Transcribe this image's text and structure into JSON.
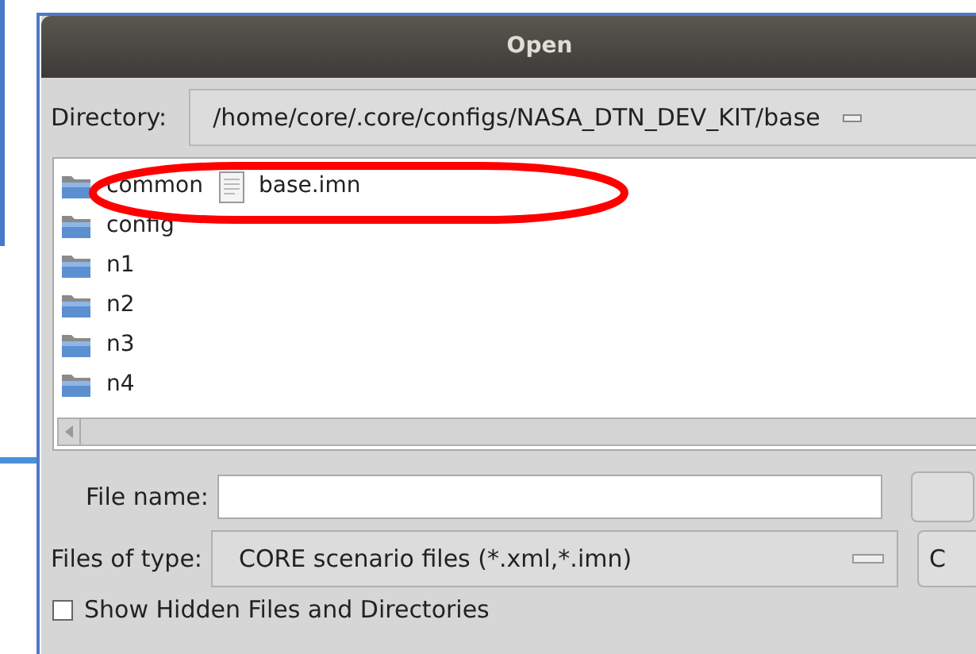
{
  "window": {
    "title": "Open"
  },
  "directory": {
    "label": "Directory:",
    "value": "/home/core/.core/configs/NASA_DTN_DEV_KIT/base"
  },
  "files": [
    [
      {
        "kind": "folder",
        "name": "common"
      },
      {
        "kind": "folder",
        "name": "config"
      },
      {
        "kind": "folder",
        "name": "n1"
      },
      {
        "kind": "folder",
        "name": "n2"
      },
      {
        "kind": "folder",
        "name": "n3"
      },
      {
        "kind": "folder",
        "name": "n4"
      }
    ],
    [
      {
        "kind": "file",
        "name": "base.imn"
      }
    ]
  ],
  "file_name": {
    "label": "File name:"
  },
  "file_type": {
    "label": "Files of type:",
    "value": "CORE scenario files (*.xml,*.imn)"
  },
  "show_hidden": {
    "label": "Show Hidden Files and Directories",
    "checked": false
  },
  "buttons": [
    {
      "label": "C"
    }
  ]
}
